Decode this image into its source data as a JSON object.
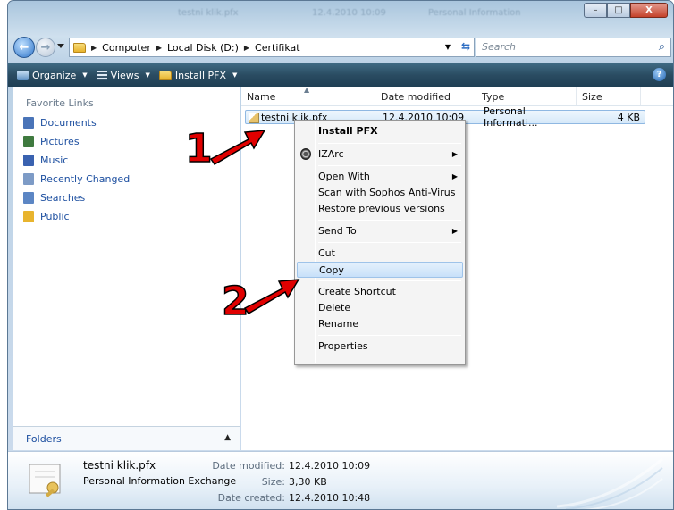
{
  "window": {
    "blurred_titles": [
      "testni klik.pfx",
      "12.4.2010 10:09",
      "Personal Information"
    ],
    "controls": {
      "minimize": "–",
      "maximize": "□",
      "close": "X"
    }
  },
  "address": {
    "crumbs": [
      "Computer",
      "Local Disk (D:)",
      "Certifikat"
    ],
    "search_placeholder": "Search"
  },
  "toolbar": {
    "organize": "Organize",
    "views": "Views",
    "install": "Install PFX",
    "help": "?"
  },
  "sidebar": {
    "header": "Favorite Links",
    "items": [
      {
        "label": "Documents",
        "color": "#4a74b8"
      },
      {
        "label": "Pictures",
        "color": "#3f7a3f"
      },
      {
        "label": "Music",
        "color": "#3a62b0"
      },
      {
        "label": "Recently Changed",
        "color": "#7d9bc6"
      },
      {
        "label": "Searches",
        "color": "#5c86c4"
      },
      {
        "label": "Public",
        "color": "#e8b42e"
      }
    ],
    "folders_label": "Folders"
  },
  "columns": [
    "Name",
    "Date modified",
    "Type",
    "Size"
  ],
  "file": {
    "name": "testni klik.pfx",
    "date": "12.4.2010 10:09",
    "type": "Personal Informati...",
    "size": "4 KB"
  },
  "context_menu": {
    "install": "Install PFX",
    "izarc": "IZArc",
    "open_with": "Open With",
    "sophos": "Scan with Sophos Anti-Virus",
    "restore": "Restore previous versions",
    "send_to": "Send To",
    "cut": "Cut",
    "copy": "Copy",
    "create_shortcut": "Create Shortcut",
    "delete": "Delete",
    "rename": "Rename",
    "properties": "Properties"
  },
  "annotations": {
    "one": "1",
    "two": "2",
    "color": "#e00000"
  },
  "details": {
    "name": "testni klik.pfx",
    "type": "Personal Information Exchange",
    "modified_label": "Date modified:",
    "modified_value": "12.4.2010 10:09",
    "size_label": "Size:",
    "size_value": "3,30 KB",
    "created_label": "Date created:",
    "created_value": "12.4.2010 10:48"
  }
}
